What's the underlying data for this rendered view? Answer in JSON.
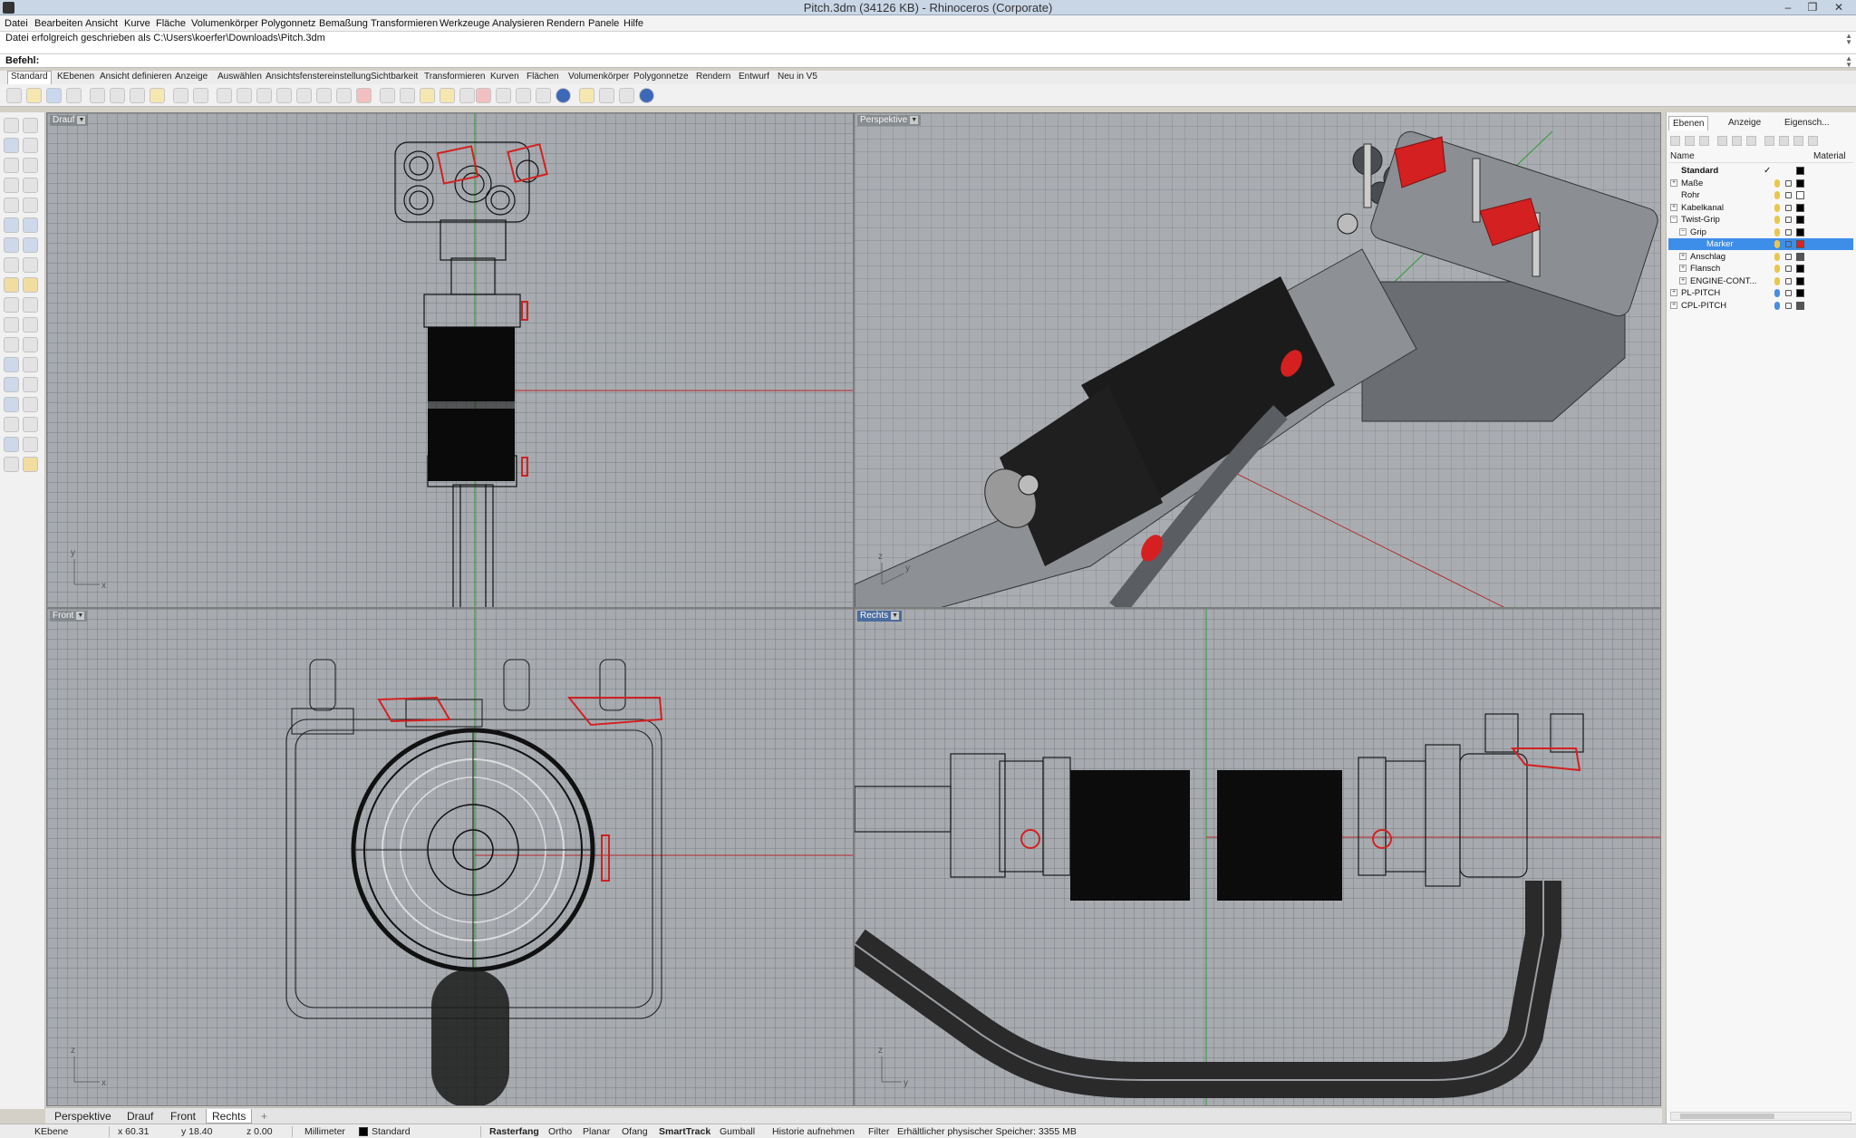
{
  "window": {
    "title": "Pitch.3dm (34126 KB) - Rhinoceros (Corporate)",
    "controls": [
      "–",
      "❐",
      "✕"
    ]
  },
  "menu": [
    "Datei",
    "Bearbeiten",
    "Ansicht",
    "Kurve",
    "Fläche",
    "Volumenkörper",
    "Polygonnetz",
    "Bemaßung",
    "Transformieren",
    "Werkzeuge",
    "Analysieren",
    "Rendern",
    "Panele",
    "Hilfe"
  ],
  "command": {
    "history": "Datei erfolgreich geschrieben als C:\\Users\\koerfer\\Downloads\\Pitch.3dm",
    "prompt_label": "Befehl:"
  },
  "toolbar_tabs": [
    "Standard",
    "KEbenen",
    "Ansicht definieren",
    "Anzeige",
    "Auswählen",
    "Ansichtsfenstereinstellung",
    "Sichtbarkeit",
    "Transformieren",
    "Kurven",
    "Flächen",
    "Volumenkörper",
    "Polygonnetze",
    "Rendern",
    "Entwurf",
    "Neu in V5"
  ],
  "viewports": {
    "top": {
      "label": "Drauf"
    },
    "perspective": {
      "label": "Perspektive"
    },
    "front": {
      "label": "Front"
    },
    "right": {
      "label": "Rechts"
    }
  },
  "axes": {
    "x": "x",
    "y": "y",
    "z": "z"
  },
  "viewport_tabs": [
    "Perspektive",
    "Drauf",
    "Front",
    "Rechts"
  ],
  "viewport_tab_add": "+",
  "panel": {
    "tabs": [
      "Ebenen",
      "Anzeige",
      "Eigensch..."
    ],
    "header_name": "Name",
    "header_material": "Material",
    "layers": [
      {
        "name": "Standard",
        "bold": true,
        "check": "✓",
        "color": "#000000"
      },
      {
        "name": "Maße",
        "expander": "+",
        "color": "#000000"
      },
      {
        "name": "Rohr",
        "color": "#ffffff"
      },
      {
        "name": "Kabelkanal",
        "expander": "+",
        "color": "#000000"
      },
      {
        "name": "Twist-Grip",
        "expander": "−",
        "color": "#000000"
      },
      {
        "name": "Grip",
        "expander": "−",
        "indent": 1,
        "color": "#000000"
      },
      {
        "name": "Marker",
        "indent": 2,
        "selected": true,
        "color": "#e02020"
      },
      {
        "name": "Anschlag",
        "expander": "+",
        "indent": 1,
        "color": "#555555"
      },
      {
        "name": "Flansch",
        "expander": "+",
        "indent": 1,
        "color": "#000000"
      },
      {
        "name": "ENGINE-CONT...",
        "expander": "+",
        "indent": 1,
        "color": "#000000"
      },
      {
        "name": "PL-PITCH",
        "expander": "+",
        "color": "#000000",
        "bulb": "blue"
      },
      {
        "name": "CPL-PITCH",
        "expander": "+",
        "color": "#555555",
        "bulb": "blue"
      }
    ]
  },
  "status": {
    "cplane": "KEbene",
    "x": "x 60.31",
    "y": "y 18.40",
    "z": "z 0.00",
    "units": "Millimeter",
    "layer": "Standard",
    "toggles": [
      "Rasterfang",
      "Ortho",
      "Planar",
      "Ofang",
      "SmartTrack",
      "Gumball",
      "Historie aufnehmen",
      "Filter"
    ],
    "bold_toggles": [
      "Rasterfang",
      "SmartTrack"
    ],
    "memory": "Erhältlicher physischer Speicher: 3355 MB"
  },
  "colors": {
    "accent": "#3d8ee8",
    "model_red": "#d42020",
    "axis_red": "#b52626",
    "axis_green": "#2f9a2f"
  }
}
